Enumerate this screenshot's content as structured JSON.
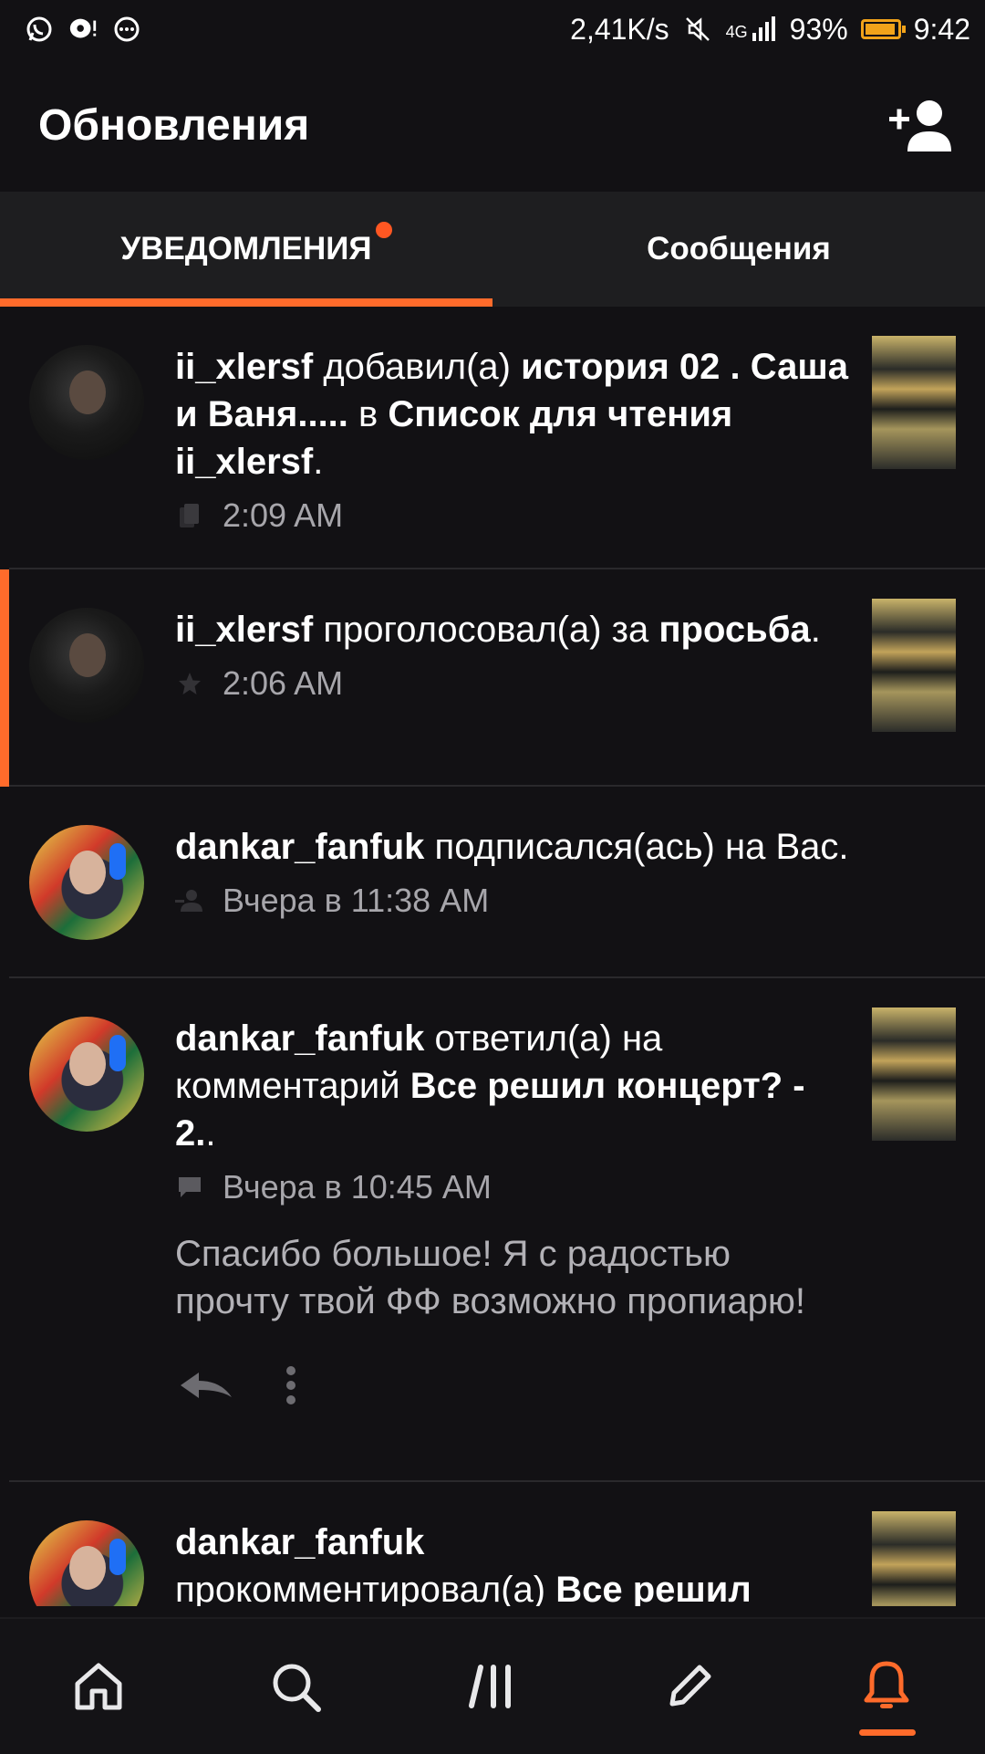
{
  "status_bar": {
    "network_speed": "2,41K/s",
    "network_type": "4G",
    "battery": "93%",
    "battery_level": 0.93,
    "time": "9:42",
    "left_icons": [
      "whatsapp-icon",
      "chat-notification-icon",
      "more-notifications-icon"
    ],
    "right_icons": [
      "mute-icon",
      "signal-icon",
      "battery-icon"
    ]
  },
  "header": {
    "title": "Обновления",
    "add_user_icon": "add-user-icon"
  },
  "tabs": [
    {
      "label": "УВЕДОМЛЕНИЯ",
      "active": true,
      "has_dot": true
    },
    {
      "label": "Сообщения",
      "active": false,
      "has_dot": false
    }
  ],
  "notifications": [
    {
      "user": "ii_xlersf",
      "parts": [
        " добавил(а) ",
        "история 02 . Саша и Ваня.....",
        " в ",
        "Список для чтения ii_xlersf",
        "."
      ],
      "time": "2:09 AM",
      "icon": "reading-list-icon"
    },
    {
      "user": "ii_xlersf",
      "parts": [
        " проголосовал(а) за ",
        "просьба",
        "."
      ],
      "time": "2:06 AM",
      "icon": "star-icon"
    },
    {
      "user": "dankar_fanfuk",
      "parts": [
        " подписался(ась) на Вас."
      ],
      "time": "Вчера в 11:38 AM",
      "icon": "follow-icon"
    },
    {
      "user": "dankar_fanfuk",
      "parts": [
        " ответил(а) на комментарий ",
        "Все решил концерт? - 2.",
        "."
      ],
      "time": "Вчера в 10:45 AM",
      "icon": "comment-icon",
      "reply": "Спасибо большое! Я с радостью прочту твой ФФ возможно пропиарю!"
    },
    {
      "user": "dankar_fanfuk",
      "parts": [
        " прокомментировал(а) ",
        "Все решил"
      ]
    }
  ],
  "bottom_nav": [
    {
      "name": "home",
      "icon": "home-icon"
    },
    {
      "name": "search",
      "icon": "search-icon"
    },
    {
      "name": "library",
      "icon": "library-icon"
    },
    {
      "name": "write",
      "icon": "pencil-icon"
    },
    {
      "name": "notifications",
      "icon": "bell-icon",
      "active": true
    }
  ],
  "colors": {
    "accent": "#ff6b2b",
    "background": "#121114",
    "tab_bar": "#1e1e20",
    "muted_text": "#a7a6ab"
  }
}
